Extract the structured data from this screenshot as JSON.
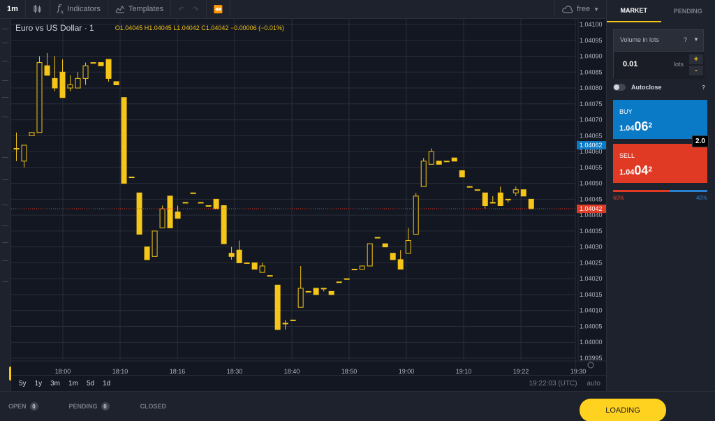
{
  "toolbar": {
    "interval": "1m",
    "indicators": "Indicators",
    "templates": "Templates",
    "plan": "free"
  },
  "chart": {
    "symbol_title": "Euro vs US Dollar · 1",
    "ohlc": "O1.04045 H1.04045 L1.04042 C1.04042 −0.00006 (−0.01%)",
    "colors": {
      "candle": "#f5c518",
      "grid": "#2a2e39",
      "ask": "#0a79c6",
      "bid": "#e03a25"
    },
    "ask_label": "1.04062",
    "bid_label": "1.04042"
  },
  "chart_data": {
    "type": "candlestick",
    "y_ticks": [
      "1.04100",
      "1.04095",
      "1.04090",
      "1.04085",
      "1.04080",
      "1.04075",
      "1.04070",
      "1.04065",
      "1.04060",
      "1.04055",
      "1.04050",
      "1.04045",
      "1.04040",
      "1.04035",
      "1.04030",
      "1.04025",
      "1.04020",
      "1.04015",
      "1.04010",
      "1.04005",
      "1.04000",
      "1.03995"
    ],
    "x_ticks": [
      "18:00",
      "18:10",
      "18:16",
      "18:30",
      "18:40",
      "18:50",
      "19:00",
      "19:10",
      "19:22",
      "19:30"
    ],
    "ylim": [
      1.03995,
      1.041
    ],
    "candles": [
      {
        "o": 1.04061,
        "h": 1.04066,
        "l": 1.04057,
        "c": 1.04061
      },
      {
        "o": 1.04057,
        "h": 1.04062,
        "l": 1.04055,
        "c": 1.04062
      },
      {
        "o": 1.04065,
        "h": 1.04066,
        "l": 1.04065,
        "c": 1.04066
      },
      {
        "o": 1.04066,
        "h": 1.0409,
        "l": 1.04066,
        "c": 1.04088
      },
      {
        "o": 1.04087,
        "h": 1.04091,
        "l": 1.04084,
        "c": 1.04084
      },
      {
        "o": 1.04083,
        "h": 1.0409,
        "l": 1.04079,
        "c": 1.0408
      },
      {
        "o": 1.04085,
        "h": 1.04089,
        "l": 1.04077,
        "c": 1.04077
      },
      {
        "o": 1.0408,
        "h": 1.04084,
        "l": 1.04079,
        "c": 1.04081
      },
      {
        "o": 1.0408,
        "h": 1.04085,
        "l": 1.0408,
        "c": 1.04083
      },
      {
        "o": 1.04083,
        "h": 1.04088,
        "l": 1.04081,
        "c": 1.04087
      },
      {
        "o": 1.04088,
        "h": 1.04088,
        "l": 1.04088,
        "c": 1.04088
      },
      {
        "o": 1.04088,
        "h": 1.04088,
        "l": 1.04087,
        "c": 1.04087
      },
      {
        "o": 1.04089,
        "h": 1.04089,
        "l": 1.04082,
        "c": 1.04083
      },
      {
        "o": 1.04082,
        "h": 1.04082,
        "l": 1.04081,
        "c": 1.04081
      },
      {
        "o": 1.04077,
        "h": 1.04077,
        "l": 1.0405,
        "c": 1.0405
      },
      {
        "o": 1.04052,
        "h": 1.04052,
        "l": 1.04052,
        "c": 1.04052
      },
      {
        "o": 1.04047,
        "h": 1.04047,
        "l": 1.04034,
        "c": 1.04034
      },
      {
        "o": 1.0403,
        "h": 1.0403,
        "l": 1.04026,
        "c": 1.04026
      },
      {
        "o": 1.04027,
        "h": 1.04035,
        "l": 1.04027,
        "c": 1.04035
      },
      {
        "o": 1.04036,
        "h": 1.04043,
        "l": 1.04036,
        "c": 1.04042
      },
      {
        "o": 1.04046,
        "h": 1.04046,
        "l": 1.04036,
        "c": 1.04036
      },
      {
        "o": 1.04041,
        "h": 1.04043,
        "l": 1.04039,
        "c": 1.04039
      },
      {
        "o": 1.04044,
        "h": 1.04044,
        "l": 1.04044,
        "c": 1.04044
      },
      {
        "o": 1.04047,
        "h": 1.04047,
        "l": 1.04047,
        "c": 1.04047
      },
      {
        "o": 1.04044,
        "h": 1.04044,
        "l": 1.04044,
        "c": 1.04044
      },
      {
        "o": 1.04043,
        "h": 1.04043,
        "l": 1.04043,
        "c": 1.04043
      },
      {
        "o": 1.04045,
        "h": 1.04045,
        "l": 1.04042,
        "c": 1.04042
      },
      {
        "o": 1.04043,
        "h": 1.04043,
        "l": 1.04031,
        "c": 1.04031
      },
      {
        "o": 1.04028,
        "h": 1.0403,
        "l": 1.04026,
        "c": 1.04027
      },
      {
        "o": 1.04029,
        "h": 1.04032,
        "l": 1.04025,
        "c": 1.04025
      },
      {
        "o": 1.04025,
        "h": 1.04025,
        "l": 1.04025,
        "c": 1.04025
      },
      {
        "o": 1.04025,
        "h": 1.04025,
        "l": 1.04023,
        "c": 1.04023
      },
      {
        "o": 1.04022,
        "h": 1.04025,
        "l": 1.04022,
        "c": 1.04024
      },
      {
        "o": 1.04021,
        "h": 1.04021,
        "l": 1.04021,
        "c": 1.04021
      },
      {
        "o": 1.04018,
        "h": 1.04018,
        "l": 1.04004,
        "c": 1.04004
      },
      {
        "o": 1.04006,
        "h": 1.04007,
        "l": 1.04004,
        "c": 1.04006
      },
      {
        "o": 1.04007,
        "h": 1.04007,
        "l": 1.04007,
        "c": 1.04007
      },
      {
        "o": 1.04011,
        "h": 1.04024,
        "l": 1.04011,
        "c": 1.04017
      },
      {
        "o": 1.04016,
        "h": 1.04016,
        "l": 1.04016,
        "c": 1.04016
      },
      {
        "o": 1.04017,
        "h": 1.04017,
        "l": 1.04015,
        "c": 1.04015
      },
      {
        "o": 1.04017,
        "h": 1.04017,
        "l": 1.04016,
        "c": 1.04017
      },
      {
        "o": 1.04016,
        "h": 1.04016,
        "l": 1.04015,
        "c": 1.04015
      },
      {
        "o": 1.04019,
        "h": 1.04019,
        "l": 1.04019,
        "c": 1.04019
      },
      {
        "o": 1.0402,
        "h": 1.0402,
        "l": 1.0402,
        "c": 1.0402
      },
      {
        "o": 1.04023,
        "h": 1.04023,
        "l": 1.04023,
        "c": 1.04023
      },
      {
        "o": 1.04023,
        "h": 1.04024,
        "l": 1.04023,
        "c": 1.04024
      },
      {
        "o": 1.04024,
        "h": 1.04031,
        "l": 1.04024,
        "c": 1.04031
      },
      {
        "o": 1.04033,
        "h": 1.04033,
        "l": 1.04033,
        "c": 1.04033
      },
      {
        "o": 1.04031,
        "h": 1.04031,
        "l": 1.0403,
        "c": 1.0403
      },
      {
        "o": 1.04028,
        "h": 1.04028,
        "l": 1.04026,
        "c": 1.04026
      },
      {
        "o": 1.04026,
        "h": 1.04029,
        "l": 1.04023,
        "c": 1.04023
      },
      {
        "o": 1.04028,
        "h": 1.04036,
        "l": 1.04028,
        "c": 1.04032
      },
      {
        "o": 1.04034,
        "h": 1.04047,
        "l": 1.04034,
        "c": 1.04046
      },
      {
        "o": 1.04049,
        "h": 1.04058,
        "l": 1.04049,
        "c": 1.04057
      },
      {
        "o": 1.04056,
        "h": 1.04061,
        "l": 1.04056,
        "c": 1.0406
      },
      {
        "o": 1.04057,
        "h": 1.04057,
        "l": 1.04056,
        "c": 1.04056
      },
      {
        "o": 1.04057,
        "h": 1.04057,
        "l": 1.04057,
        "c": 1.04057
      },
      {
        "o": 1.04058,
        "h": 1.04058,
        "l": 1.04057,
        "c": 1.04057
      },
      {
        "o": 1.04054,
        "h": 1.04054,
        "l": 1.04052,
        "c": 1.04052
      },
      {
        "o": 1.04049,
        "h": 1.04049,
        "l": 1.04049,
        "c": 1.04049
      },
      {
        "o": 1.04048,
        "h": 1.04048,
        "l": 1.04048,
        "c": 1.04048
      },
      {
        "o": 1.04047,
        "h": 1.04047,
        "l": 1.04042,
        "c": 1.04043
      },
      {
        "o": 1.04044,
        "h": 1.04046,
        "l": 1.04044,
        "c": 1.04044
      },
      {
        "o": 1.04047,
        "h": 1.04049,
        "l": 1.04043,
        "c": 1.04043
      },
      {
        "o": 1.04045,
        "h": 1.04045,
        "l": 1.04044,
        "c": 1.04045
      },
      {
        "o": 1.04047,
        "h": 1.04049,
        "l": 1.04046,
        "c": 1.04048
      },
      {
        "o": 1.04048,
        "h": 1.04048,
        "l": 1.04046,
        "c": 1.04046
      },
      {
        "o": 1.04045,
        "h": 1.04045,
        "l": 1.04042,
        "c": 1.04042
      }
    ]
  },
  "timeframes": [
    "5y",
    "1y",
    "3m",
    "1m",
    "5d",
    "1d"
  ],
  "footer": {
    "clock": "19:22:03 (UTC)",
    "scale": "auto"
  },
  "bottom": {
    "open_label": "OPEN",
    "open_count": "0",
    "pending_label": "PENDING",
    "pending_count": "0",
    "closed_label": "CLOSED",
    "loading": "LOADING"
  },
  "panel": {
    "tab_market": "MARKET",
    "tab_pending": "PENDING",
    "volume_label": "Volume in lots",
    "help": "?",
    "lots_value": "0.01",
    "lots_unit": "lots",
    "plus": "+",
    "minus": "-",
    "autoclose": "Autoclose",
    "buy_label": "BUY",
    "buy_small": "1.04",
    "buy_big": "06",
    "buy_sup": "2",
    "sell_label": "SELL",
    "sell_small": "1.04",
    "sell_big": "04",
    "sell_sup": "2",
    "spread": "2.0",
    "sell_pct": "60%",
    "buy_pct": "40%",
    "sell_share": 0.6
  }
}
